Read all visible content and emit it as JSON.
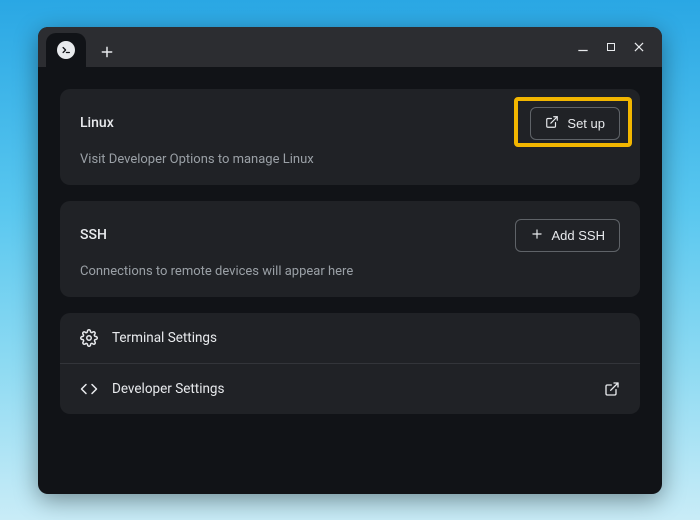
{
  "cards": {
    "linux": {
      "title": "Linux",
      "subtitle": "Visit Developer Options to manage Linux",
      "button_label": "Set up"
    },
    "ssh": {
      "title": "SSH",
      "subtitle": "Connections to remote devices will appear here",
      "button_label": "Add SSH"
    }
  },
  "settings": {
    "terminal_label": "Terminal Settings",
    "developer_label": "Developer Settings"
  }
}
